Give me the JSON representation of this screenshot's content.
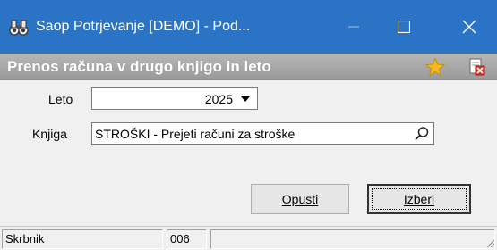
{
  "window": {
    "title": "Saop Potrjevanje [DEMO] - Pod...",
    "app_icon": "binoculars-icon",
    "controls": [
      "minimize-icon",
      "maximize-icon",
      "close-icon"
    ],
    "titlebar_color": "#2b73c4"
  },
  "header": {
    "title": "Prenos računa v drugo knjigo in leto",
    "favorite_icon": "star-icon",
    "report_icon": "report-delete-icon",
    "background": "#a8a8a8"
  },
  "form": {
    "leto": {
      "label": "Leto",
      "value": "2025"
    },
    "knjiga": {
      "label": "Knjiga",
      "value": "STROŠKI - Prejeti računi za stroške",
      "lookup_icon": "search-icon"
    }
  },
  "buttons": {
    "cancel": {
      "label": "Opusti"
    },
    "ok": {
      "label": "Izberi"
    }
  },
  "statusbar": {
    "user": "Skrbnik",
    "code": "006",
    "extra": ""
  }
}
